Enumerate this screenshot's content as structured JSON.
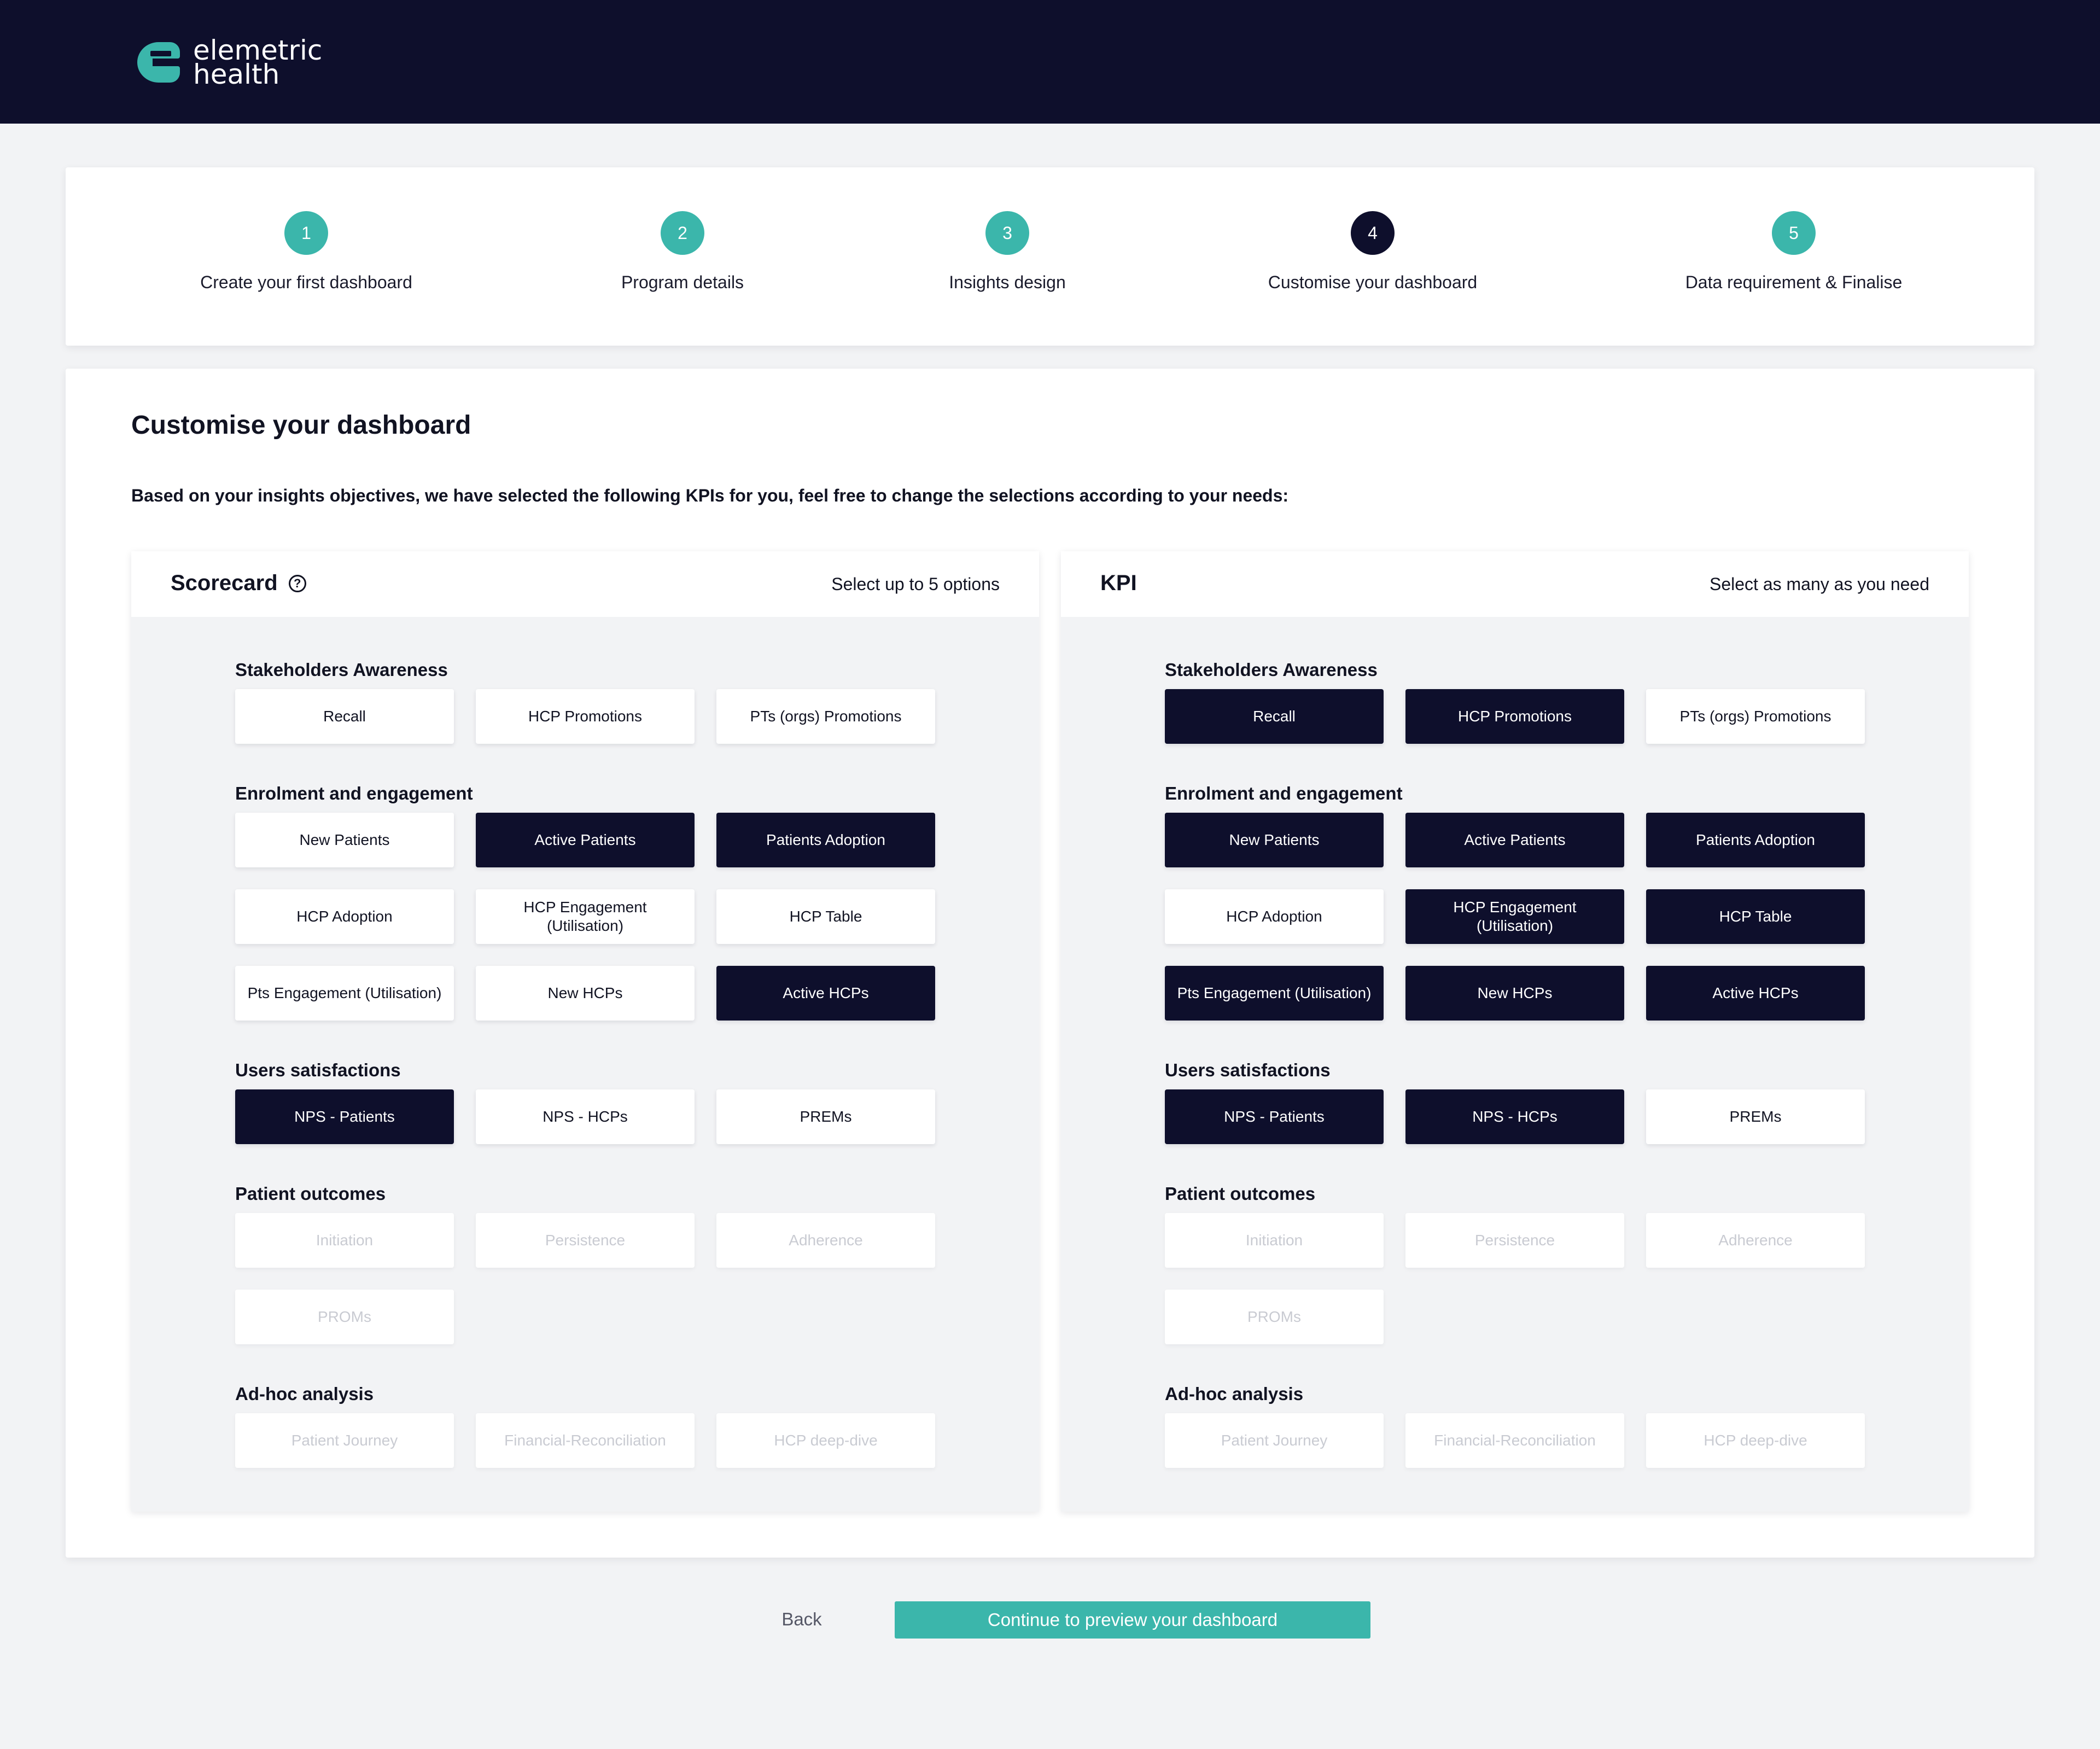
{
  "brand": {
    "line1": "elemetric",
    "line2": "health",
    "accent": "#3bb6ab",
    "navy": "#0e0f2c"
  },
  "steps": [
    {
      "number": "1",
      "label": "Create your first dashboard"
    },
    {
      "number": "2",
      "label": "Program details"
    },
    {
      "number": "3",
      "label": "Insights design"
    },
    {
      "number": "4",
      "label": "Customise your dashboard",
      "active": true
    },
    {
      "number": "5",
      "label": "Data requirement & Finalise"
    }
  ],
  "page": {
    "title": "Customise your dashboard",
    "intro": "Based on your insights objectives, we have selected the following KPIs for you, feel free to change the selections according to your needs:"
  },
  "scorecard": {
    "title": "Scorecard",
    "help_icon": "question-circle-icon",
    "hint": "Select up to 5 options",
    "groups": [
      {
        "title": "Stakeholders Awareness",
        "options": [
          {
            "label": "Recall",
            "state": "default"
          },
          {
            "label": "HCP Promotions",
            "state": "default"
          },
          {
            "label": "PTs (orgs) Promotions",
            "state": "default"
          }
        ]
      },
      {
        "title": "Enrolment and engagement",
        "options": [
          {
            "label": "New Patients",
            "state": "default"
          },
          {
            "label": "Active Patients",
            "state": "selected"
          },
          {
            "label": "Patients Adoption",
            "state": "selected"
          },
          {
            "label": "HCP Adoption",
            "state": "default"
          },
          {
            "label": "HCP Engagement (Utilisation)",
            "state": "default"
          },
          {
            "label": "HCP Table",
            "state": "default"
          },
          {
            "label": "Pts Engagement (Utilisation)",
            "state": "default"
          },
          {
            "label": "New HCPs",
            "state": "default"
          },
          {
            "label": "Active HCPs",
            "state": "selected"
          }
        ]
      },
      {
        "title": "Users satisfactions",
        "options": [
          {
            "label": "NPS - Patients",
            "state": "selected"
          },
          {
            "label": "NPS - HCPs",
            "state": "default"
          },
          {
            "label": "PREMs",
            "state": "default"
          }
        ]
      },
      {
        "title": "Patient outcomes",
        "options": [
          {
            "label": "Initiation",
            "state": "disabled"
          },
          {
            "label": "Persistence",
            "state": "disabled"
          },
          {
            "label": "Adherence",
            "state": "disabled"
          },
          {
            "label": "PROMs",
            "state": "disabled"
          }
        ]
      },
      {
        "title": "Ad-hoc analysis",
        "options": [
          {
            "label": "Patient Journey",
            "state": "disabled"
          },
          {
            "label": "Financial-Reconciliation",
            "state": "disabled"
          },
          {
            "label": "HCP deep-dive",
            "state": "disabled"
          }
        ]
      }
    ]
  },
  "kpi": {
    "title": "KPI",
    "hint": "Select as many as you need",
    "groups": [
      {
        "title": "Stakeholders Awareness",
        "options": [
          {
            "label": "Recall",
            "state": "selected"
          },
          {
            "label": "HCP Promotions",
            "state": "selected"
          },
          {
            "label": "PTs (orgs) Promotions",
            "state": "default"
          }
        ]
      },
      {
        "title": "Enrolment and engagement",
        "options": [
          {
            "label": "New Patients",
            "state": "selected"
          },
          {
            "label": "Active Patients",
            "state": "selected"
          },
          {
            "label": "Patients Adoption",
            "state": "selected"
          },
          {
            "label": "HCP Adoption",
            "state": "default"
          },
          {
            "label": "HCP Engagement (Utilisation)",
            "state": "selected"
          },
          {
            "label": "HCP Table",
            "state": "selected"
          },
          {
            "label": "Pts Engagement (Utilisation)",
            "state": "selected"
          },
          {
            "label": "New HCPs",
            "state": "selected"
          },
          {
            "label": "Active HCPs",
            "state": "selected"
          }
        ]
      },
      {
        "title": "Users satisfactions",
        "options": [
          {
            "label": "NPS - Patients",
            "state": "selected"
          },
          {
            "label": "NPS - HCPs",
            "state": "selected"
          },
          {
            "label": "PREMs",
            "state": "default"
          }
        ]
      },
      {
        "title": "Patient outcomes",
        "options": [
          {
            "label": "Initiation",
            "state": "disabled"
          },
          {
            "label": "Persistence",
            "state": "disabled"
          },
          {
            "label": "Adherence",
            "state": "disabled"
          },
          {
            "label": "PROMs",
            "state": "disabled"
          }
        ]
      },
      {
        "title": "Ad-hoc analysis",
        "options": [
          {
            "label": "Patient Journey",
            "state": "disabled"
          },
          {
            "label": "Financial-Reconciliation",
            "state": "disabled"
          },
          {
            "label": "HCP deep-dive",
            "state": "disabled"
          }
        ]
      }
    ]
  },
  "footer": {
    "back": "Back",
    "continue": "Continue to preview your dashboard"
  }
}
